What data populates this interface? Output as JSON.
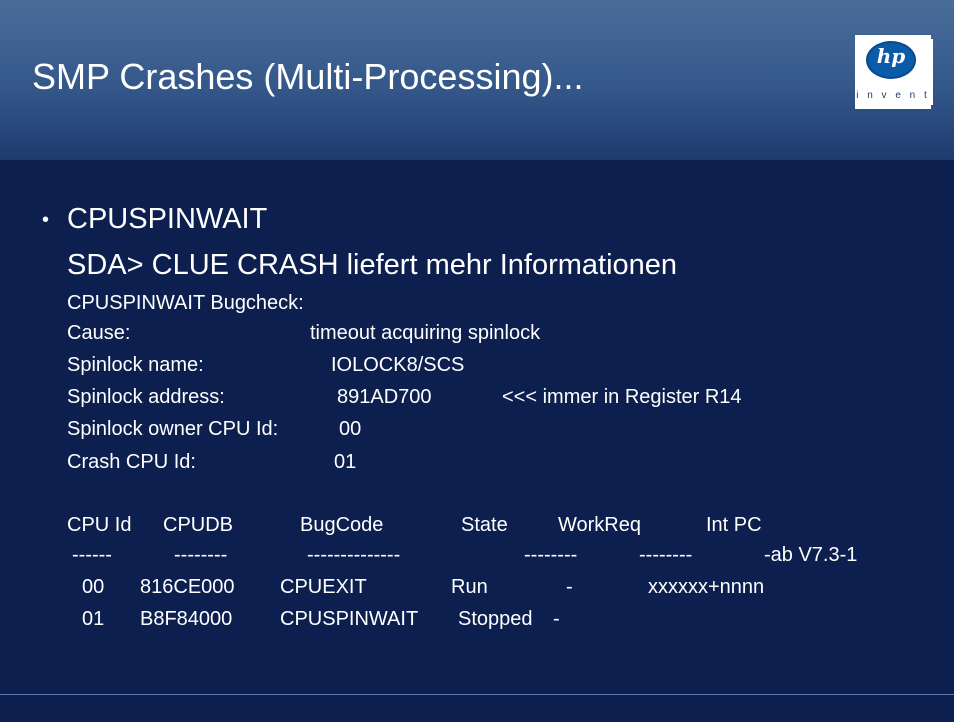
{
  "slide": {
    "title": "SMP Crashes (Multi-Processing)...",
    "logo": {
      "brand": "hp",
      "tagline": "i n v e n t"
    },
    "bullet": {
      "glyph": "•",
      "heading": "CPUSPINWAIT",
      "subheading": "SDA> CLUE CRASH liefert mehr Informationen"
    },
    "details": {
      "bugcheck": "CPUSPINWAIT Bugcheck:",
      "cause_label": "Cause:",
      "cause_value": "timeout acquiring spinlock",
      "name_label": "Spinlock name:",
      "name_value": "IOLOCK8/SCS",
      "address_label": "Spinlock address:",
      "address_value": "891AD700",
      "address_note": "<<< immer in Register R14",
      "owner_label": "Spinlock owner CPU Id:",
      "owner_value": "00",
      "crash_label": "Crash CPU Id:",
      "crash_value": "01"
    },
    "table": {
      "headers": [
        "CPU Id",
        "CPUDB",
        "BugCode",
        "State",
        "WorkReq",
        "Int PC"
      ],
      "separators": [
        "------",
        "--------",
        "--------------",
        "--------",
        "--------"
      ],
      "version_note": "-ab V7.3-1",
      "rows": [
        [
          "00",
          "816CE000",
          "CPUEXIT",
          "Run",
          "-",
          "xxxxxx+nnnn"
        ],
        [
          "01",
          "B8F84000",
          "CPUSPINWAIT",
          "Stopped",
          "-",
          ""
        ]
      ]
    }
  }
}
